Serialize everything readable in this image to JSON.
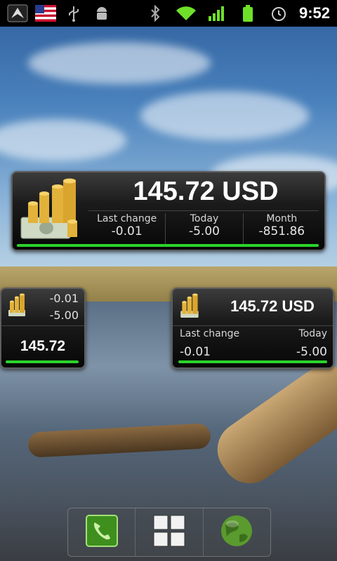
{
  "status_bar": {
    "time": "9:52",
    "left_icons": [
      "notification-app-icon",
      "us-flag-icon",
      "usb-icon",
      "android-debug-icon"
    ],
    "right_icons": [
      "bluetooth-icon",
      "wifi-icon",
      "signal-icon",
      "battery-icon",
      "alarm-icon"
    ]
  },
  "widgets": {
    "large": {
      "value": "145.72 USD",
      "stats": [
        {
          "label": "Last change",
          "value": "-0.01"
        },
        {
          "label": "Today",
          "value": "-5.00"
        },
        {
          "label": "Month",
          "value": "-851.86"
        }
      ]
    },
    "small": {
      "last_change": "-0.01",
      "today": "-5.00",
      "value": "145.72"
    },
    "medium": {
      "value": "145.72 USD",
      "last_change_label": "Last change",
      "today_label": "Today",
      "last_change": "-0.01",
      "today": "-5.00"
    }
  },
  "dock": {
    "items": [
      "phone-icon",
      "app-drawer-icon",
      "browser-globe-icon"
    ]
  },
  "colors": {
    "progress_green": "#2bd32b",
    "widget_border": "#5e5e5e",
    "phone_green": "#4caf2a"
  }
}
